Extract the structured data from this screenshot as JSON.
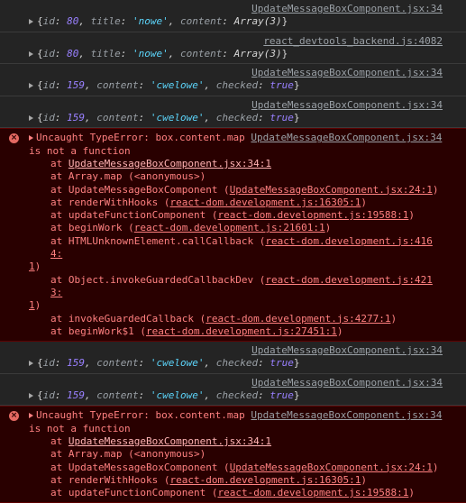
{
  "log_messages": [
    {
      "source": "UpdateMessageBoxComponent.jsx:34",
      "id": "80",
      "title": "'nowe'",
      "content": "Array(3)"
    },
    {
      "source": "react_devtools_backend.js:4082",
      "id": "80",
      "title": "'nowe'",
      "content": "Array(3)"
    },
    {
      "source": "UpdateMessageBoxComponent.jsx:34",
      "id": "159",
      "content": "'cwelowe'",
      "checked": "true"
    },
    {
      "source": "UpdateMessageBoxComponent.jsx:34",
      "id": "159",
      "content": "'cwelowe'",
      "checked": "true"
    },
    {
      "source": "UpdateMessageBoxComponent.jsx:34",
      "id": "159",
      "content": "'cwelowe'",
      "checked": "true"
    },
    {
      "source": "UpdateMessageBoxComponent.jsx:34",
      "id": "159",
      "content": "'cwelowe'",
      "checked": "true"
    }
  ],
  "error": {
    "head": "Uncaught TypeError: box.content.map",
    "source": "UpdateMessageBoxComponent.jsx:34",
    "cont": "is not a function",
    "frames": [
      {
        "at": "at ",
        "fn": "",
        "link": "UpdateMessageBoxComponent.jsx:34:1",
        "tail": ""
      },
      {
        "at": "at ",
        "fn": "Array.map (<anonymous>)",
        "link": "",
        "tail": ""
      },
      {
        "at": "at ",
        "fn": "UpdateMessageBoxComponent (",
        "link": "UpdateMessageBoxComponent.jsx:24:1",
        "tail": ")"
      },
      {
        "at": "at ",
        "fn": "renderWithHooks (",
        "link": "react-dom.development.js:16305:1",
        "tail": ")"
      },
      {
        "at": "at ",
        "fn": "updateFunctionComponent (",
        "link": "react-dom.development.js:19588:1",
        "tail": ")"
      },
      {
        "at": "at ",
        "fn": "beginWork (",
        "link": "react-dom.development.js:21601:1",
        "tail": ")"
      },
      {
        "at": "at ",
        "fn": "HTMLUnknownElement.callCallback (",
        "link": "react-dom.development.js:4164:",
        "tail": "",
        "wrap": "1",
        "wraptail": ")"
      },
      {
        "at": "at ",
        "fn": "Object.invokeGuardedCallbackDev (",
        "link": "react-dom.development.js:4213:",
        "tail": "",
        "wrap": "1",
        "wraptail": ")"
      },
      {
        "at": "at ",
        "fn": "invokeGuardedCallback (",
        "link": "react-dom.development.js:4277:1",
        "tail": ")"
      },
      {
        "at": "at ",
        "fn": "beginWork$1 (",
        "link": "react-dom.development.js:27451:1",
        "tail": ")"
      }
    ],
    "frames_partial": [
      {
        "at": "at ",
        "fn": "",
        "link": "UpdateMessageBoxComponent.jsx:34:1",
        "tail": ""
      },
      {
        "at": "at ",
        "fn": "Array.map (<anonymous>)",
        "link": "",
        "tail": ""
      },
      {
        "at": "at ",
        "fn": "UpdateMessageBoxComponent (",
        "link": "UpdateMessageBoxComponent.jsx:24:1",
        "tail": ")"
      },
      {
        "at": "at ",
        "fn": "renderWithHooks (",
        "link": "react-dom.development.js:16305:1",
        "tail": ")"
      },
      {
        "at": "at ",
        "fn": "updateFunctionComponent (",
        "link": "react-dom.development.js:19588:1",
        "tail": ")"
      }
    ]
  },
  "icons": {
    "error": "error-circle-icon",
    "expand": "expand-triangle-icon"
  },
  "colors": {
    "background": "#242424",
    "error_bg": "#290000",
    "error_text": "#ff8080",
    "string": "#5cd5fb",
    "number": "#9980ff"
  }
}
